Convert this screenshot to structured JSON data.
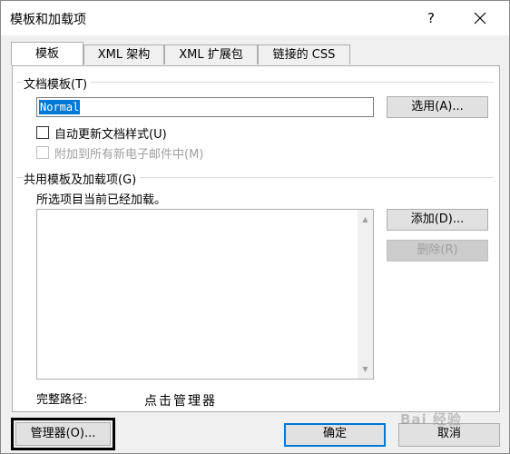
{
  "window": {
    "title": "模板和加载项",
    "help_label": "?"
  },
  "tabs": [
    {
      "label": "模板",
      "active": true
    },
    {
      "label": "XML 架构",
      "active": false
    },
    {
      "label": "XML 扩展包",
      "active": false
    },
    {
      "label": "链接的 CSS",
      "active": false
    }
  ],
  "document_template": {
    "group_label": "文档模板(T)",
    "value": "Normal",
    "choose_button": "选用(A)...",
    "auto_update_label": "自动更新文档样式(U)",
    "auto_update_checked": false,
    "attach_email_label": "附加到所有新电子邮件中(M)",
    "attach_email_checked": false
  },
  "global_templates": {
    "group_label": "共用模板及加载项(G)",
    "description": "所选项目当前已经加载。",
    "items": [],
    "add_button": "添加(D)...",
    "remove_button": "删除(R)",
    "full_path_label": "完整路径:"
  },
  "annotation": {
    "text": "点击管理器"
  },
  "footer": {
    "organizer_button": "管理器(O)...",
    "ok_button": "确定",
    "cancel_button": "取消"
  },
  "watermark": {
    "text": "Bai 经验"
  },
  "colors": {
    "selection": "#0078d7",
    "primary_border": "#0078d7",
    "highlight_box": "#000000"
  }
}
